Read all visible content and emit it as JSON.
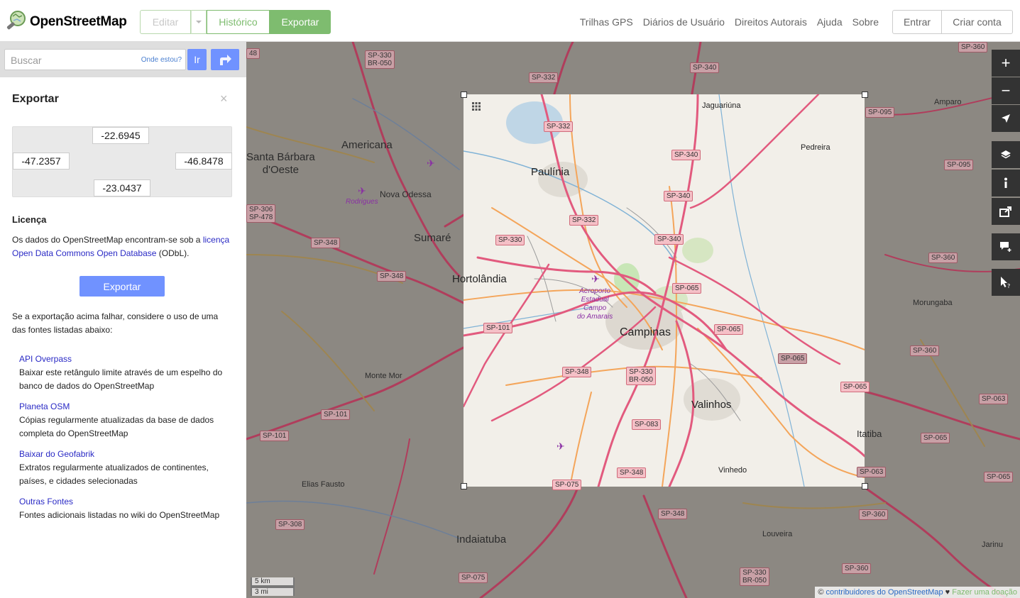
{
  "header": {
    "brand": "OpenStreetMap",
    "edit_label": "Editar",
    "history_label": "Histórico",
    "export_label": "Exportar",
    "nav": [
      "Trilhas GPS",
      "Diários de Usuário",
      "Direitos Autorais",
      "Ajuda",
      "Sobre"
    ],
    "login_label": "Entrar",
    "signup_label": "Criar conta"
  },
  "search": {
    "placeholder": "Buscar",
    "where_am_i": "Onde estou?",
    "go_label": "Ir"
  },
  "export_panel": {
    "title": "Exportar",
    "close": "×",
    "bbox": {
      "north": "-22.6945",
      "west": "-47.2357",
      "east": "-46.8478",
      "south": "-23.0437"
    },
    "license_heading": "Licença",
    "license_text_1": "Os dados do OpenStreetMap encontram-se sob a ",
    "license_link": "licença Open Data Commons Open Database",
    "license_text_2": " (ODbL).",
    "export_button": "Exportar",
    "fallback_text": "Se a exportação acima falhar, considere o uso de uma das fontes listadas abaixo:",
    "sources": [
      {
        "title": "API Overpass",
        "desc": "Baixar este retângulo limite através de um espelho do banco de dados do OpenStreetMap"
      },
      {
        "title": "Planeta OSM",
        "desc": "Cópias regularmente atualizadas da base de dados completa do OpenStreetMap"
      },
      {
        "title": "Baixar do Geofabrik",
        "desc": "Extratos regularmente atualizados de continentes, países, e cidades selecionadas"
      },
      {
        "title": "Outras Fontes",
        "desc": "Fontes adicionais listadas no wiki do OpenStreetMap"
      }
    ]
  },
  "map": {
    "places": {
      "americana": "Americana",
      "santa_barbara": "Santa Bárbara\nd'Oeste",
      "nova_odessa": "Nova Odessa",
      "paulinia": "Paulínia",
      "jaguariuna": "Jaguariúna",
      "pedreira": "Pedreira",
      "amparo": "Amparo",
      "sumare": "Sumaré",
      "hortolandia": "Hortolândia",
      "campinas": "Campinas",
      "monte_mor": "Monte Mor",
      "valinhos": "Valinhos",
      "morungaba": "Morungaba",
      "itatiba": "Itatiba",
      "vinhedo": "Vinhedo",
      "elias_fausto": "Elias Fausto",
      "indaiatuba": "Indaiatuba",
      "louveira": "Louveira",
      "jarinu": "Jarinu",
      "rodrigues": "Rodrigues",
      "aeroporto": "Aeroporto\nEstadual\nCampo\ndo Amarais"
    },
    "shields": {
      "sp330_br050_top": "SP-330\nBR-050",
      "sp332_top": "SP-332",
      "sp340_top": "SP-340",
      "sp360_top": "SP-360",
      "sp332_a": "SP-332",
      "sp095_a": "SP-095",
      "sp340_a": "SP-340",
      "sp095_b": "SP-095",
      "sp340_b": "SP-340",
      "sp306_478": "SP-306\nSP-478",
      "sp332_b": "SP-332",
      "sp330": "SP-330",
      "sp340_c": "SP-340",
      "sp348_a": "SP-348",
      "sp360_a": "SP-360",
      "sp348_b": "SP-348",
      "sp065_a": "SP-065",
      "sp101_a": "SP-101",
      "sp065_b": "SP-065",
      "sp360_b": "SP-360",
      "sp065_c": "SP-065",
      "sp348_c": "SP-348",
      "sp330_br050_mid": "SP-330\nBR-050",
      "sp065_d": "SP-065",
      "sp101_b": "SP-101",
      "sp063_a": "SP-063",
      "sp083": "SP-083",
      "sp101_c": "SP-101",
      "sp065_e": "SP-065",
      "sp348_d": "SP-348",
      "sp063_b": "SP-063",
      "sp065_f": "SP-065",
      "sp075_a": "SP-075",
      "sp348_e": "SP-348",
      "sp360_c": "SP-360",
      "sp308": "SP-308",
      "sp075_b": "SP-075",
      "sp360_d": "SP-360",
      "sp330_br050_bot": "SP-330\nBR-050",
      "sp48": "48"
    },
    "scale_km": "5 km",
    "scale_mi": "3 mi",
    "attribution_prefix": "© ",
    "attribution_link": "contribuidores do OpenStreetMap",
    "attribution_heart": " ♥ ",
    "attribution_donate": "Fazer uma doação"
  },
  "map_controls": [
    "zoom-in",
    "zoom-out",
    "locate",
    "layers",
    "info",
    "share",
    "note",
    "query"
  ]
}
